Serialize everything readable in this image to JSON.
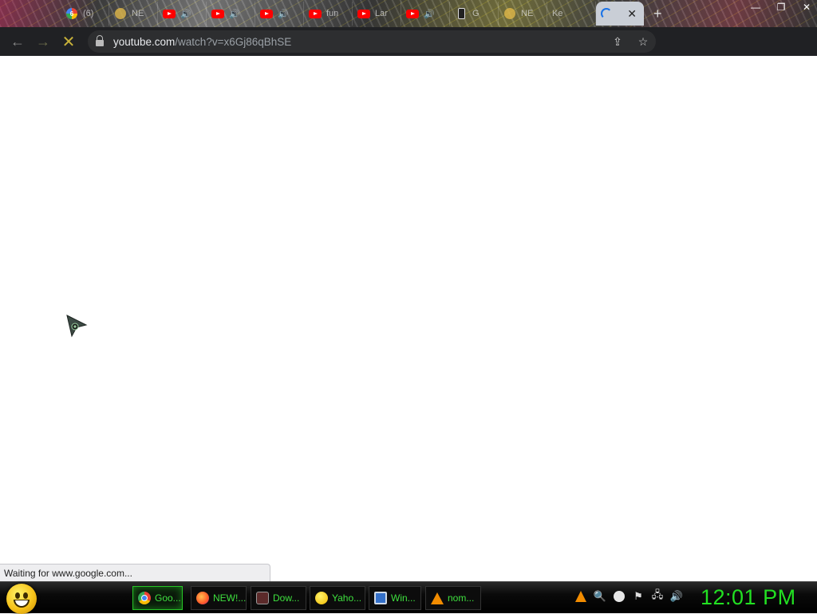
{
  "browser": {
    "tabs": [
      {
        "icon": "google-icon",
        "title": "(6)",
        "badge": "6"
      },
      {
        "icon": "emoji-icon",
        "title": "NE"
      },
      {
        "icon": "youtube-icon",
        "title": "",
        "audio": true
      },
      {
        "icon": "youtube-icon",
        "title": "",
        "audio": true
      },
      {
        "icon": "youtube-icon",
        "title": "",
        "audio": true
      },
      {
        "icon": "youtube-icon",
        "title": "fun"
      },
      {
        "icon": "youtube-icon",
        "title": "Lar"
      },
      {
        "icon": "youtube-icon",
        "title": "",
        "audio": true
      },
      {
        "icon": "phone-icon",
        "title": "G"
      },
      {
        "icon": "emoji-icon",
        "title": "NE"
      }
    ],
    "active_tab": {
      "title": "Ke",
      "loading": true
    },
    "new_tab_label": "+",
    "window_controls": {
      "minimize": "—",
      "restore": "❐",
      "close": "✕"
    },
    "url_host": "youtube.com",
    "url_path": "/watch?v=x6Gj86qBhSE",
    "status_text": "Waiting for www.google.com...",
    "accent_color": "#d4b23a"
  },
  "taskbar": {
    "items": [
      {
        "icon": "chrome-icon",
        "label": "Goo...",
        "active": true
      },
      {
        "icon": "firefox-icon",
        "label": "NEW!..."
      },
      {
        "icon": "download-icon",
        "label": "Dow..."
      },
      {
        "icon": "yahoo-messenger-icon",
        "label": "Yaho..."
      },
      {
        "icon": "window-icon",
        "label": "Win..."
      },
      {
        "icon": "vlc-icon",
        "label": "nom..."
      }
    ],
    "clock": "12:01 PM",
    "clock_color": "#22e022",
    "tray_icons": [
      "vlc-icon",
      "search-key-icon",
      "messenger-icon",
      "action-center-flag-icon",
      "network-icon",
      "volume-icon"
    ]
  }
}
